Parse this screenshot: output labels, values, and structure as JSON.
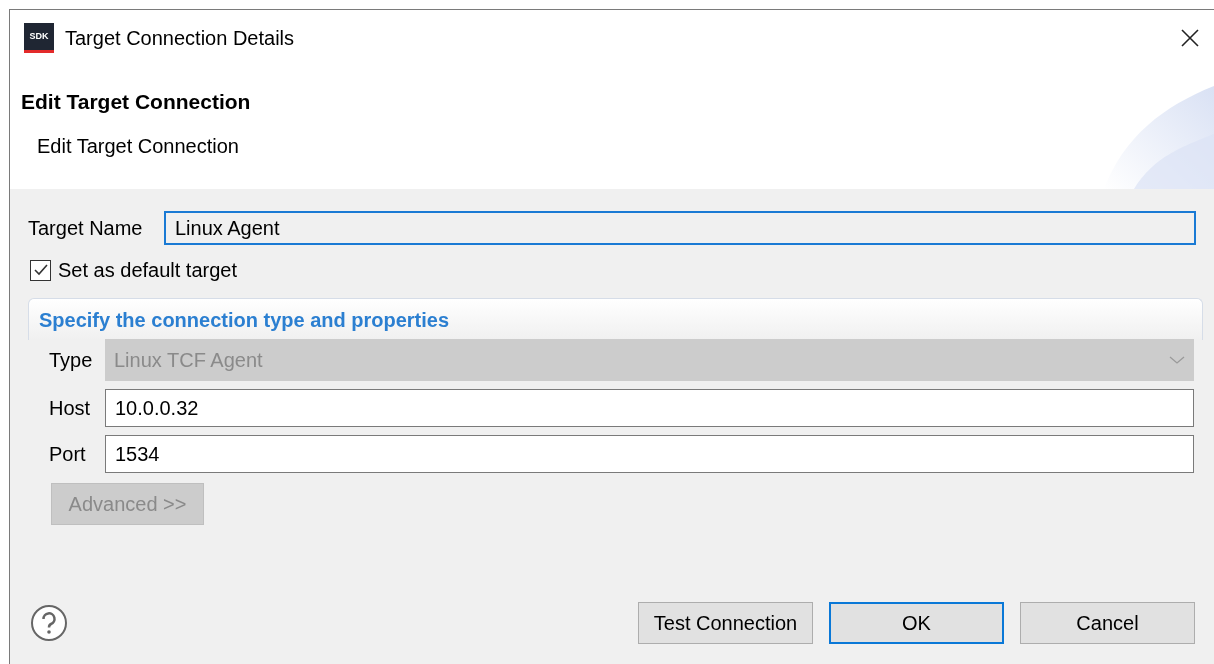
{
  "window": {
    "logo_text": "SDK",
    "title": "Target Connection Details"
  },
  "header": {
    "title": "Edit Target Connection",
    "subtitle": "Edit Target Connection"
  },
  "target_name": {
    "label": "Target Name",
    "value": "Linux Agent",
    "focused": true
  },
  "default_target": {
    "label": "Set as default target",
    "checked": true
  },
  "section": {
    "title": "Specify the connection type and properties",
    "fields": [
      {
        "kind": "dropdown",
        "label": "Type",
        "value": "Linux TCF Agent",
        "disabled": true
      },
      {
        "kind": "text",
        "label": "Host",
        "value": "10.0.0.32",
        "disabled": false
      },
      {
        "kind": "text",
        "label": "Port",
        "value": "1534",
        "disabled": false
      }
    ],
    "advanced": {
      "label": "Advanced >>",
      "disabled": true
    }
  },
  "buttons": [
    {
      "label": "Test Connection",
      "default": false
    },
    {
      "label": "OK",
      "default": true
    },
    {
      "label": "Cancel",
      "default": false
    }
  ]
}
